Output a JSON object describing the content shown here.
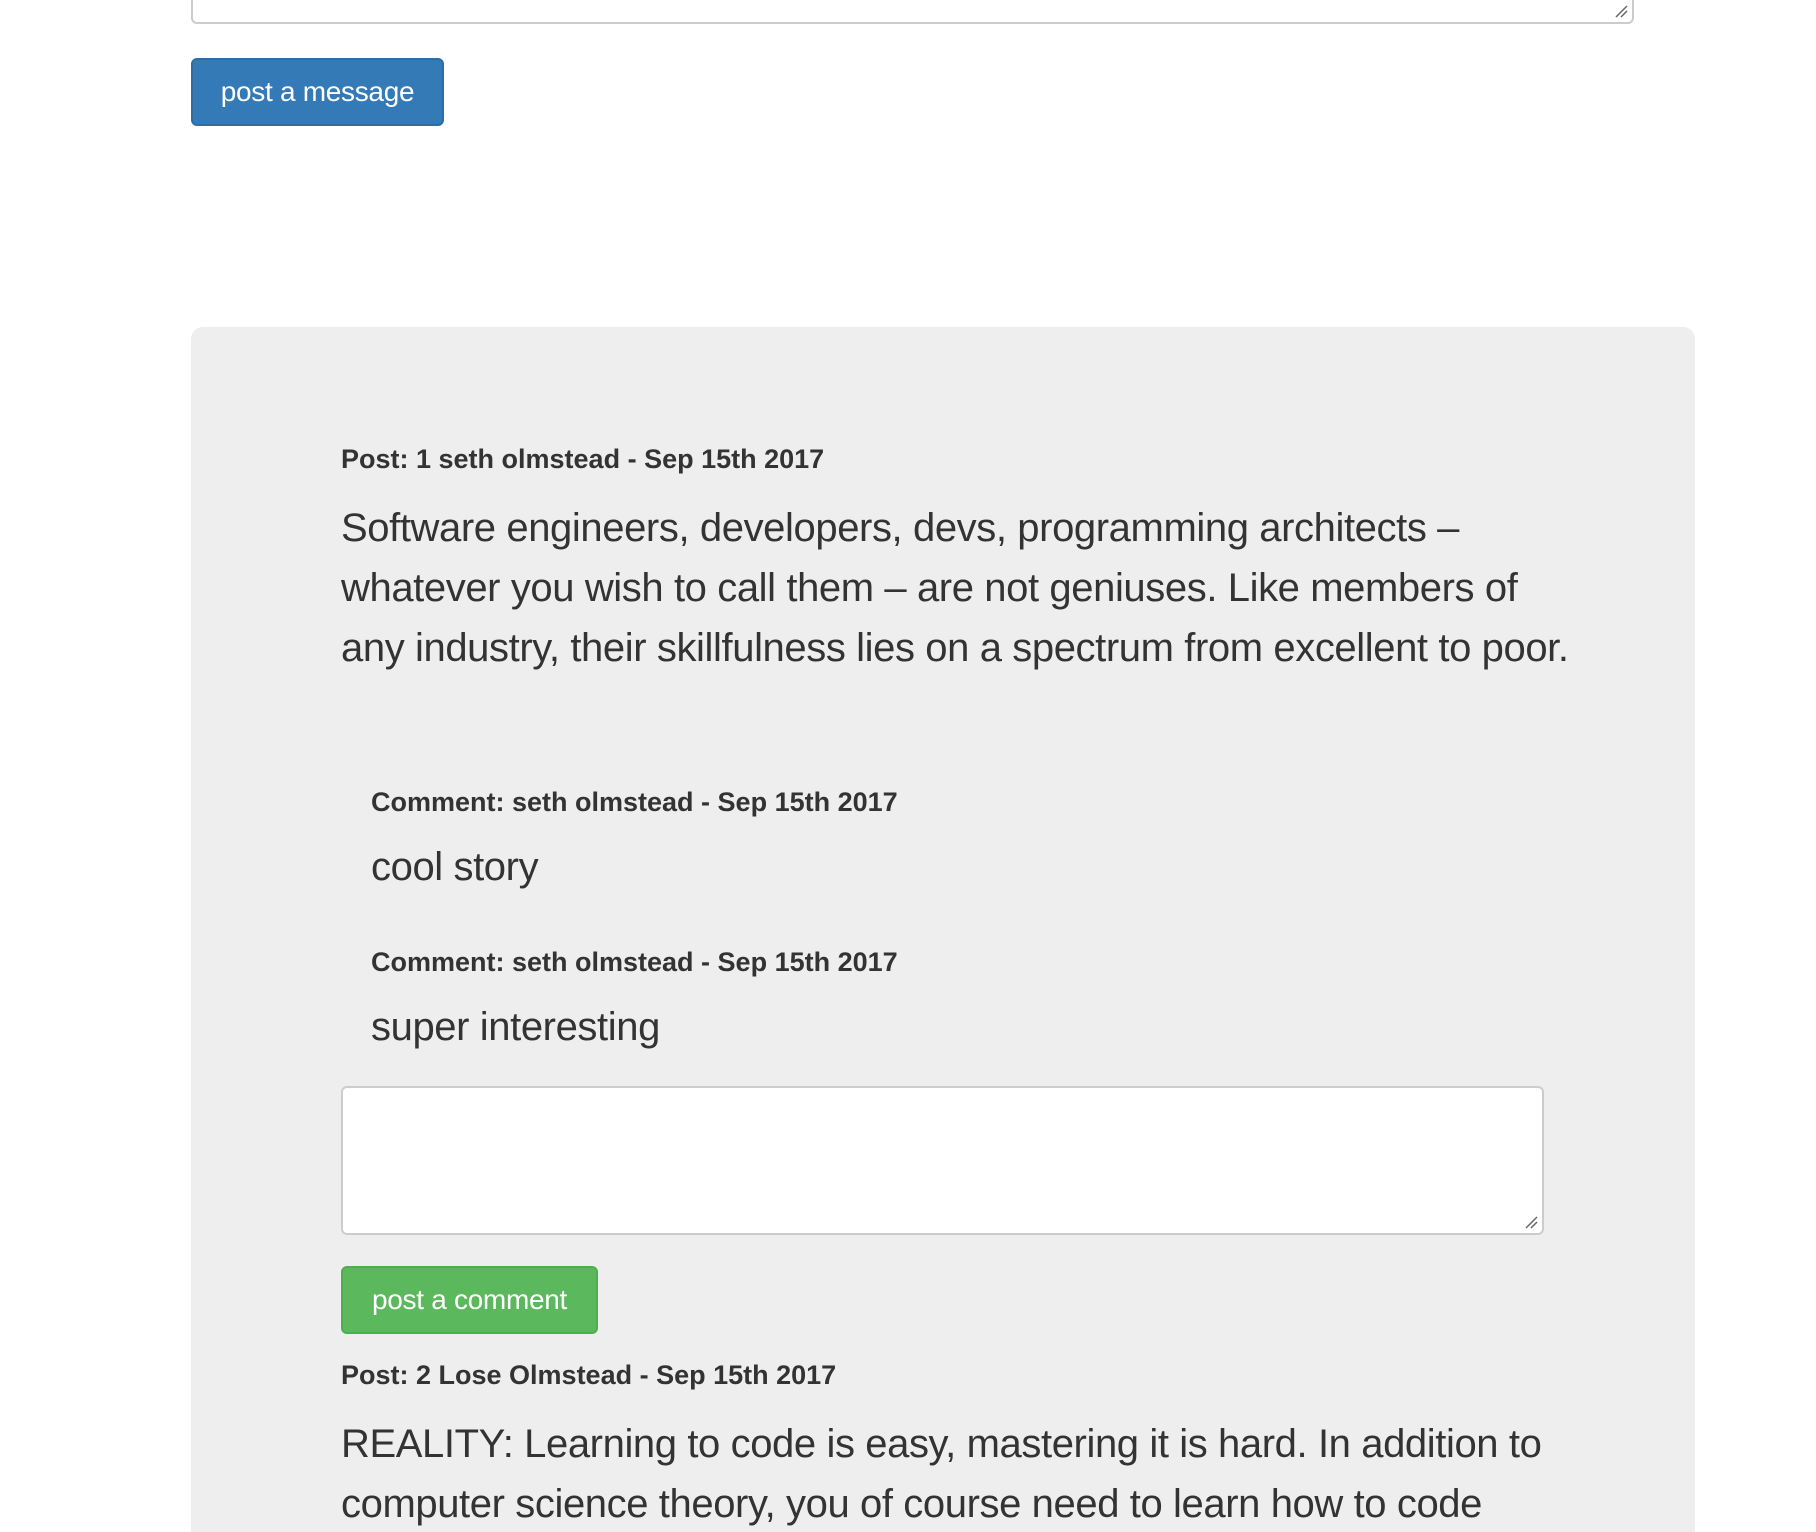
{
  "message_form": {
    "textarea_value": "",
    "submit_label": "post a message"
  },
  "posts": [
    {
      "header": "Post: 1 seth olmstead - Sep 15th 2017",
      "body": "Software engineers, developers, devs, programming architects – whatever you wish to call them – are not geniuses. Like members of any industry, their skillfulness lies on a spectrum from excellent to poor.",
      "comments": [
        {
          "header": "Comment: seth olmstead - Sep 15th 2017",
          "body": "cool story"
        },
        {
          "header": "Comment: seth olmstead - Sep 15th 2017",
          "body": "super interesting"
        }
      ],
      "comment_form": {
        "textarea_value": "",
        "submit_label": "post a comment"
      }
    },
    {
      "header": "Post: 2 Lose Olmstead - Sep 15th 2017",
      "body": "REALITY: Learning to code is easy, mastering it is hard. In addition to computer science theory, you of course need to learn how to code"
    }
  ],
  "colors": {
    "primary": "#337ab7",
    "success": "#5cb85c",
    "panel_bg": "#eeeeee",
    "text": "#333333"
  }
}
